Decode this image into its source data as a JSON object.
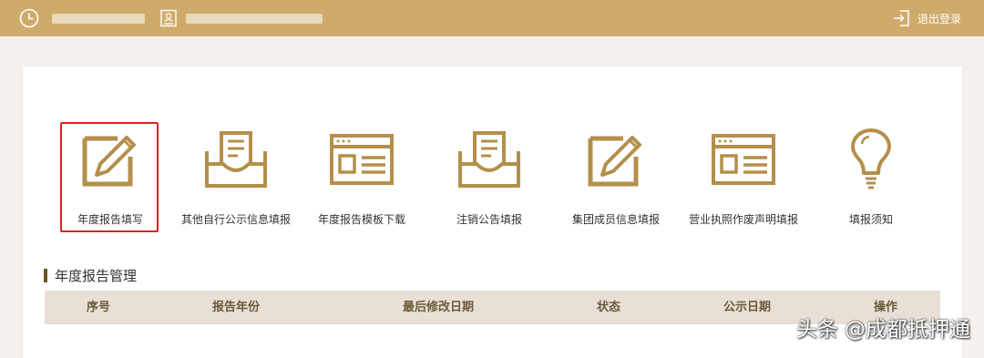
{
  "header": {
    "logout_label": "退出登录",
    "icons": [
      "clock-icon",
      "id-card-icon",
      "logout-icon"
    ],
    "background": "#cfab6b"
  },
  "functions": [
    {
      "label": "年度报告填写",
      "icon": "edit-form-icon",
      "selected": true
    },
    {
      "label": "其他自行公示信息填报",
      "icon": "inbox-document-icon",
      "selected": false
    },
    {
      "label": "年度报告模板下载",
      "icon": "template-window-icon",
      "selected": false
    },
    {
      "label": "注销公告填报",
      "icon": "inbox-document-icon",
      "selected": false
    },
    {
      "label": "集团成员信息填报",
      "icon": "edit-form-icon",
      "selected": false
    },
    {
      "label": "营业执照作废声明填报",
      "icon": "template-window-icon",
      "selected": false
    },
    {
      "label": "填报须知",
      "icon": "lightbulb-icon",
      "selected": false
    }
  ],
  "section": {
    "title": "年度报告管理"
  },
  "table": {
    "columns": [
      "序号",
      "报告年份",
      "最后修改日期",
      "状态",
      "公示日期",
      "操作"
    ]
  },
  "watermark": "头条 @成都抵押通",
  "colors": {
    "icon_gold": "#b48f4b",
    "highlight_red": "#e02020",
    "table_header_bg": "#e8e0d6"
  }
}
